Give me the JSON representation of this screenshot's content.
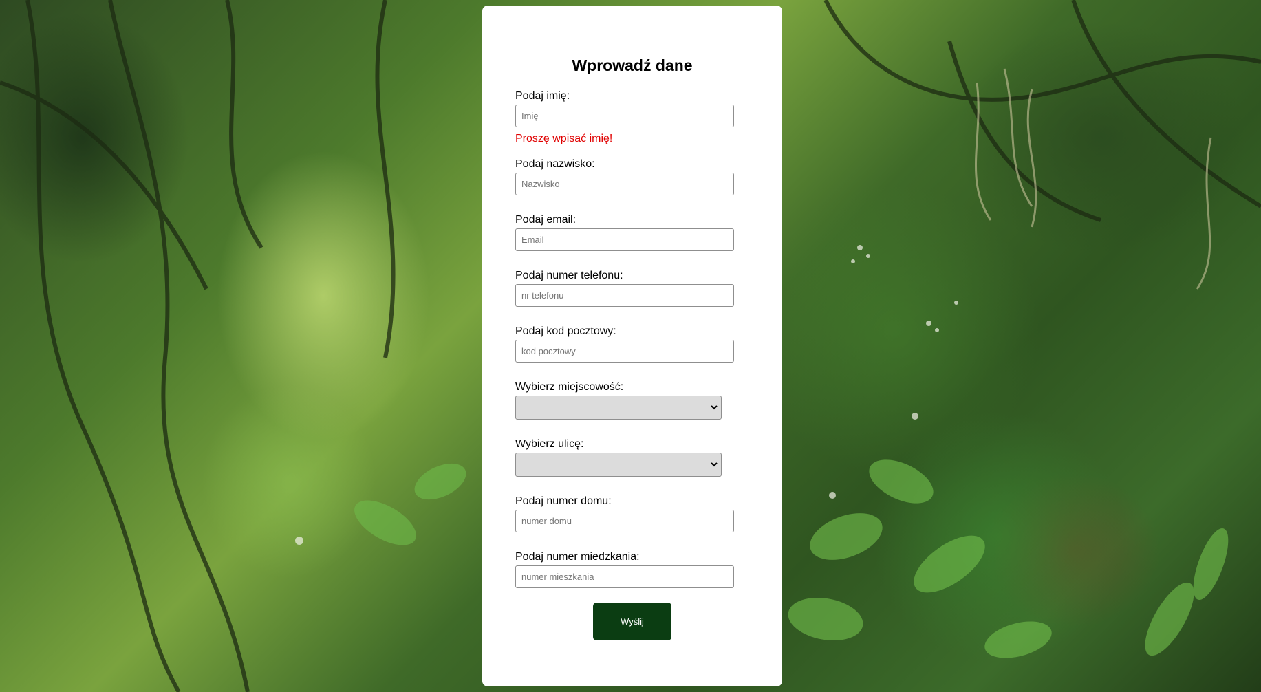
{
  "form": {
    "title": "Wprowadź dane",
    "first_name": {
      "label": "Podaj imię:",
      "placeholder": "Imię",
      "value": "",
      "error": "Proszę wpisać imię!"
    },
    "last_name": {
      "label": "Podaj nazwisko:",
      "placeholder": "Nazwisko",
      "value": ""
    },
    "email": {
      "label": "Podaj email:",
      "placeholder": "Email",
      "value": ""
    },
    "phone": {
      "label": "Podaj numer telefonu:",
      "placeholder": "nr telefonu",
      "value": ""
    },
    "postal_code": {
      "label": "Podaj kod pocztowy:",
      "placeholder": "kod pocztowy",
      "value": ""
    },
    "city": {
      "label": "Wybierz miejscowość:",
      "selected": ""
    },
    "street": {
      "label": "Wybierz ulicę:",
      "selected": ""
    },
    "house_number": {
      "label": "Podaj numer domu:",
      "placeholder": "numer domu",
      "value": ""
    },
    "apartment_number": {
      "label": "Podaj numer miedzkania:",
      "placeholder": "numer mieszkania",
      "value": ""
    },
    "submit_label": "Wyślij"
  },
  "colors": {
    "error": "#e00000",
    "submit_button": "#0b3d12",
    "card": "#ffffff"
  },
  "icons": {
    "select_arrow": "chevron-down-icon"
  }
}
